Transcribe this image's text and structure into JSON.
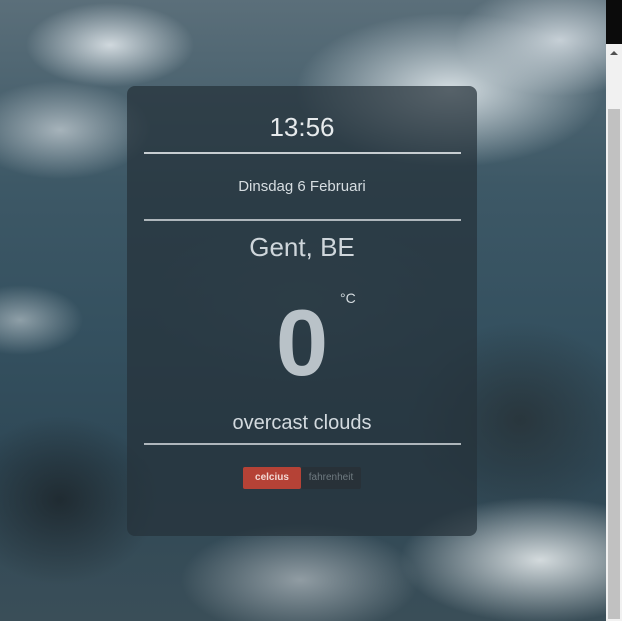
{
  "widget": {
    "time": "13:56",
    "date": "Dinsdag 6 Februari",
    "location": "Gent, BE",
    "temperature": "0",
    "temperature_unit": "°C",
    "condition": "overcast clouds",
    "unit_toggle": {
      "celsius_label": "celcius",
      "fahrenheit_label": "fahrenheit",
      "selected": "celcius"
    }
  },
  "colors": {
    "accent": "#b54236",
    "card_bg": "rgba(38,50,58,0.72)"
  },
  "icons": {
    "scroll_up": "chevron-up-icon"
  }
}
